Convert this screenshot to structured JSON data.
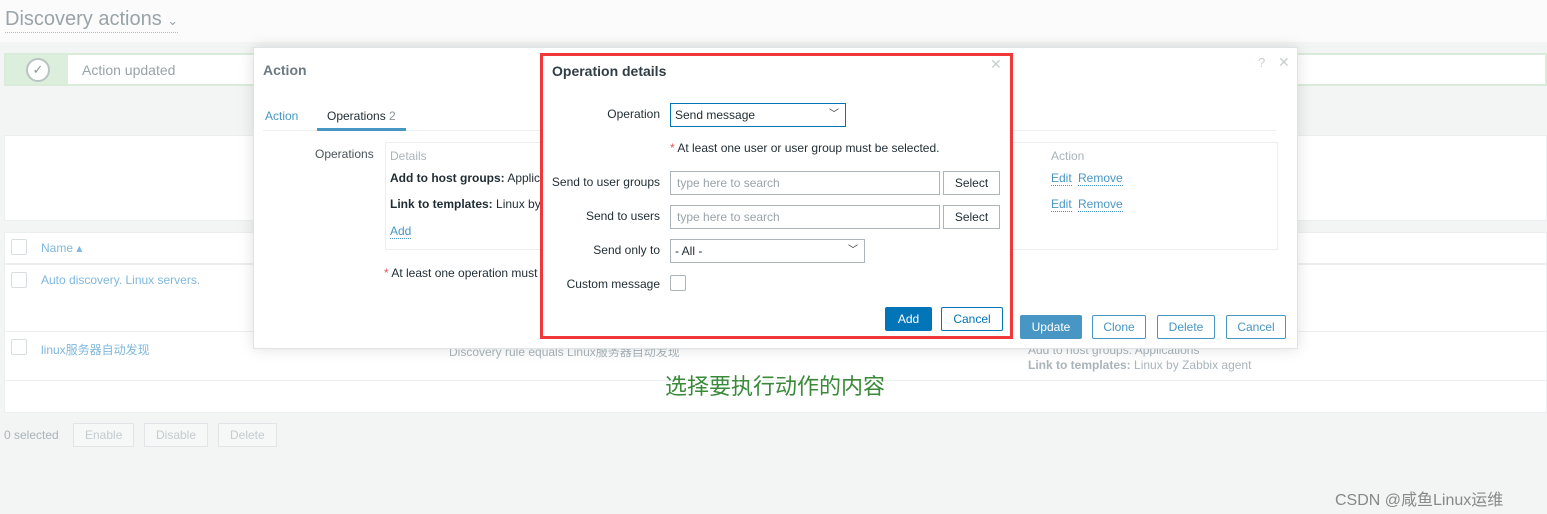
{
  "page": {
    "title": "Discovery actions",
    "message": "Action updated"
  },
  "table": {
    "header_name": "Name",
    "rows": [
      {
        "name": "Auto discovery. Linux servers."
      },
      {
        "name": "linux服务器自动发现",
        "conditions": "Discovery rule equals Linux服务器自动发现",
        "op_groups": "Add to host groups: Applications",
        "op_templates_label": "Link to templates:",
        "op_templates_value": "Linux by Zabbix agent"
      }
    ]
  },
  "footer": {
    "selected": "0 selected",
    "enable": "Enable",
    "disable": "Disable",
    "delete": "Delete"
  },
  "action_dialog": {
    "title": "Action",
    "help": "?",
    "close": "✕",
    "tabs": [
      {
        "label": "Action"
      },
      {
        "label": "Operations",
        "count": "2"
      }
    ],
    "operations_label": "Operations",
    "col_details": "Details",
    "col_action": "Action",
    "ops": [
      {
        "label": "Add to host groups:",
        "value": "Applic",
        "edit": "Edit",
        "remove": "Remove"
      },
      {
        "label": "Link to templates:",
        "value": "Linux by",
        "edit": "Edit",
        "remove": "Remove"
      }
    ],
    "add": "Add",
    "required_note": "At least one operation must",
    "buttons": {
      "update": "Update",
      "clone": "Clone",
      "delete": "Delete",
      "cancel": "Cancel"
    }
  },
  "operation_details": {
    "title": "Operation details",
    "close": "✕",
    "operation_label": "Operation",
    "operation_value": "Send message",
    "note": "At least one user or user group must be selected.",
    "user_groups_label": "Send to user groups",
    "users_label": "Send to users",
    "placeholder": "type here to search",
    "select": "Select",
    "send_only_label": "Send only to",
    "send_only_value": "- All -",
    "custom_message_label": "Custom message",
    "custom_message_checked": false,
    "add": "Add",
    "cancel": "Cancel"
  },
  "annotation": "选择要执行动作的内容",
  "watermark": "CSDN @咸鱼Linux运维",
  "colors": {
    "accent": "#0275b8",
    "highlight_border": "#f0383a",
    "annotation": "#3a8a3a"
  }
}
